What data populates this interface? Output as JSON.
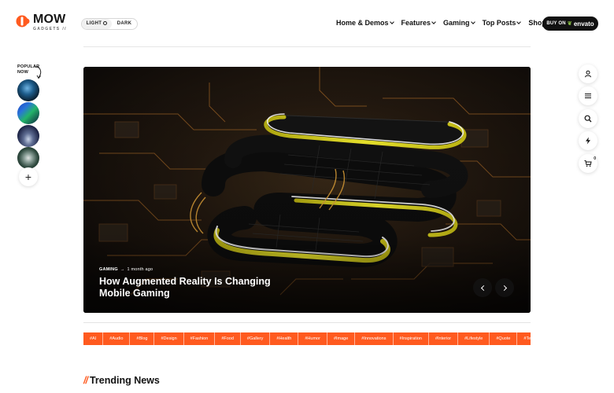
{
  "header": {
    "logo": {
      "name": "MOW",
      "sub": "GADGETS //"
    },
    "theme_toggle": {
      "light": "LIGHT",
      "dark": "DARK"
    },
    "nav": [
      {
        "label": "Home & Demos"
      },
      {
        "label": "Features"
      },
      {
        "label": "Gaming"
      },
      {
        "label": "Top Posts"
      },
      {
        "label": "Shop"
      }
    ],
    "buy_button": {
      "prefix": "BUY ON",
      "brand": "envato"
    }
  },
  "popular": {
    "label_line1": "POPULAR",
    "label_line2": "NOW",
    "add": "+"
  },
  "side_rail": {
    "cart_count": "0"
  },
  "hero": {
    "category": "GAMING",
    "arrow": "→",
    "time": "1 month ago",
    "title": "How Augmented Reality Is Changing Mobile Gaming"
  },
  "tags": [
    "#AI",
    "#Audio",
    "#Blog",
    "#Design",
    "#Fashion",
    "#Food",
    "#Gallery",
    "#Health",
    "#Humor",
    "#Image",
    "#Innovations",
    "#Inspiration",
    "#Interior",
    "#Lifestyle",
    "#Quote",
    "#Technology"
  ],
  "trending": {
    "slashes": "//",
    "title": "Trending News"
  },
  "colors": {
    "accent": "#ff5a1f",
    "dark": "#111111",
    "hero_glow": "#e8e02a"
  },
  "icons": [
    "user-icon",
    "menu-icon",
    "search-icon",
    "bolt-icon",
    "cart-icon",
    "chevron-left-icon",
    "chevron-right-icon",
    "plus-icon",
    "sun-icon",
    "logo-icon"
  ]
}
